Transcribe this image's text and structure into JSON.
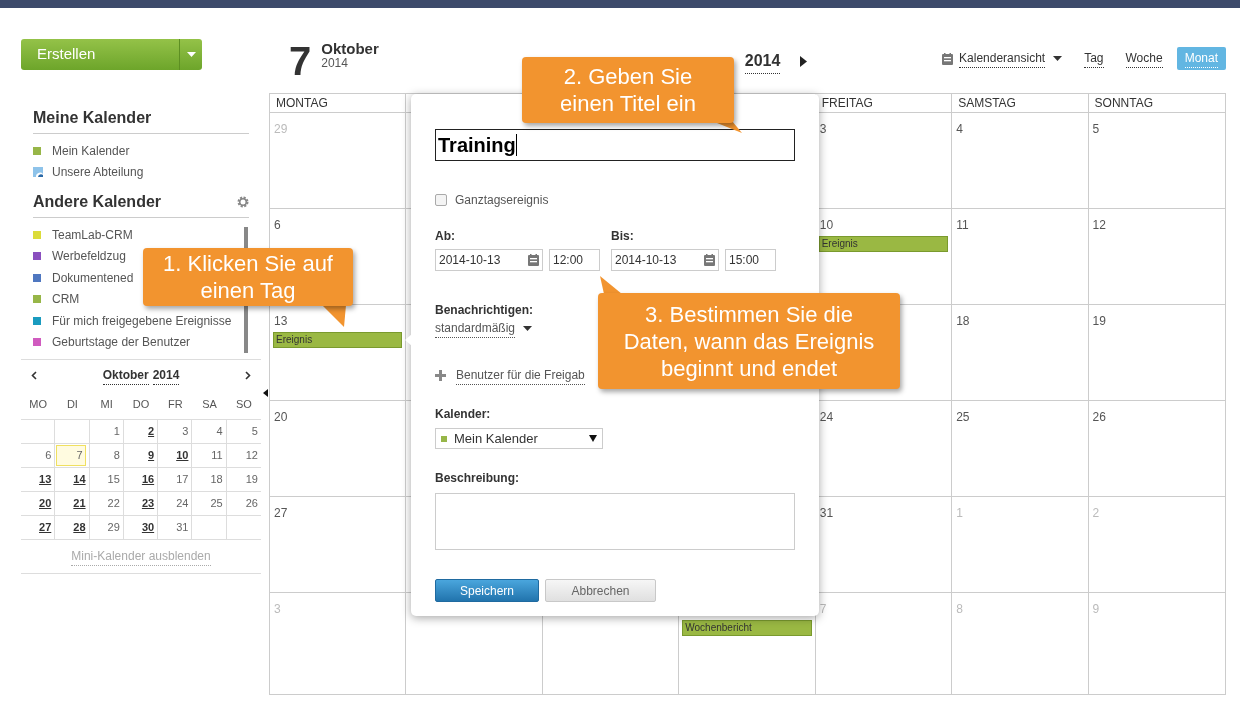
{
  "create_button": {
    "label": "Erstellen"
  },
  "my_calendars": {
    "title": "Meine Kalender",
    "items": [
      {
        "label": "Mein Kalender",
        "kind": "own",
        "color": "#97b648"
      },
      {
        "label": "Unsere Abteilung",
        "kind": "shared"
      }
    ]
  },
  "other_calendars": {
    "title": "Andere Kalender",
    "items": [
      {
        "label": "TeamLab-CRM",
        "color": "#dcdc3a"
      },
      {
        "label": "Werbefeldzug",
        "color": "#8a4fbf"
      },
      {
        "label": "Dokumentened",
        "color": "#4f77c0"
      },
      {
        "label": "CRM",
        "color": "#97b648"
      },
      {
        "label": "Für mich freigegebene Ereignisse",
        "color": "#1a9bbf"
      },
      {
        "label": "Geburtstage der Benutzer",
        "color": "#d05bbf"
      }
    ]
  },
  "mini_calendar": {
    "month": "Oktober",
    "year": "2014",
    "weekdays": [
      "MO",
      "DI",
      "MI",
      "DO",
      "FR",
      "SA",
      "SO"
    ],
    "weeks": [
      [
        {
          "day": "1",
          "bold": false,
          "today": false
        },
        {
          "day": "2",
          "bold": true,
          "today": false
        },
        {
          "day": "3",
          "bold": false,
          "today": false
        },
        {
          "day": "4",
          "bold": false,
          "today": false
        },
        {
          "day": "5",
          "bold": false,
          "today": false
        }
      ],
      [
        {
          "day": "6",
          "bold": false,
          "today": false
        },
        {
          "day": "7",
          "bold": false,
          "today": true
        },
        {
          "day": "8",
          "bold": false,
          "today": false
        },
        {
          "day": "9",
          "bold": true,
          "today": false
        },
        {
          "day": "10",
          "bold": true,
          "today": false
        },
        {
          "day": "11",
          "bold": false,
          "today": false
        },
        {
          "day": "12",
          "bold": false,
          "today": false
        }
      ],
      [
        {
          "day": "13",
          "bold": true,
          "today": false
        },
        {
          "day": "14",
          "bold": true,
          "today": false
        },
        {
          "day": "15",
          "bold": false,
          "today": false
        },
        {
          "day": "16",
          "bold": true,
          "today": false
        },
        {
          "day": "17",
          "bold": false,
          "today": false
        },
        {
          "day": "18",
          "bold": false,
          "today": false
        },
        {
          "day": "19",
          "bold": false,
          "today": false
        }
      ],
      [
        {
          "day": "20",
          "bold": true,
          "today": false
        },
        {
          "day": "21",
          "bold": true,
          "today": false
        },
        {
          "day": "22",
          "bold": false,
          "today": false
        },
        {
          "day": "23",
          "bold": true,
          "today": false
        },
        {
          "day": "24",
          "bold": false,
          "today": false
        },
        {
          "day": "25",
          "bold": false,
          "today": false
        },
        {
          "day": "26",
          "bold": false,
          "today": false
        }
      ],
      [
        {
          "day": "27",
          "bold": true,
          "today": false
        },
        {
          "day": "28",
          "bold": true,
          "today": false
        },
        {
          "day": "29",
          "bold": false,
          "today": false
        },
        {
          "day": "30",
          "bold": true,
          "today": false
        },
        {
          "day": "31",
          "bold": false,
          "today": false
        }
      ]
    ],
    "hide_link": "Mini-Kalender ausblenden"
  },
  "date_badge": {
    "day": "7",
    "month": "Oktober",
    "year": "2014"
  },
  "month_title": "2014",
  "view_switch": {
    "label": "Kalenderansicht",
    "views": [
      {
        "label": "Tag",
        "selected": false
      },
      {
        "label": "Woche",
        "selected": false
      },
      {
        "label": "Monat",
        "selected": true
      }
    ]
  },
  "month_grid": {
    "weekdays": {
      "mo": "MONTAG",
      "fr": "FREITAG",
      "sa": "SAMSTAG",
      "so": "SONNTAG"
    },
    "weeks": [
      {
        "mo": {
          "day": "29",
          "other_month": true
        },
        "fr": {
          "day": "3",
          "other_month": false
        },
        "sa": {
          "day": "4",
          "other_month": false
        },
        "so": {
          "day": "5",
          "other_month": false
        }
      },
      {
        "mo": {
          "day": "6",
          "other_month": false
        },
        "fr": {
          "day": "10",
          "other_month": false,
          "events": [
            "Ereignis"
          ]
        },
        "sa": {
          "day": "11",
          "other_month": false
        },
        "so": {
          "day": "12",
          "other_month": false
        }
      },
      {
        "mo": {
          "day": "13",
          "other_month": false,
          "events": [
            "Ereignis"
          ]
        },
        "sa": {
          "day": "18",
          "other_month": false
        },
        "so": {
          "day": "19",
          "other_month": false
        }
      },
      {
        "mo": {
          "day": "20",
          "other_month": false
        },
        "fr": {
          "day": "24",
          "other_month": false
        },
        "sa": {
          "day": "25",
          "other_month": false
        },
        "so": {
          "day": "26",
          "other_month": false
        }
      },
      {
        "mo": {
          "day": "27",
          "other_month": false
        },
        "fr": {
          "day": "31",
          "other_month": false
        },
        "sa": {
          "day": "1",
          "other_month": true
        },
        "so": {
          "day": "2",
          "other_month": true
        }
      },
      {
        "mo": {
          "day": "3",
          "other_month": true
        },
        "do": {
          "events": [
            "Wochenbericht"
          ]
        },
        "fr": {
          "day": "7",
          "other_month": true
        },
        "sa": {
          "day": "8",
          "other_month": true
        },
        "so": {
          "day": "9",
          "other_month": true
        }
      }
    ]
  },
  "event_form": {
    "title_value": "Training",
    "all_day": {
      "label": "Ganztagsereignis",
      "checked": false
    },
    "from": {
      "label": "Ab:",
      "date": "2014-10-13",
      "time": "12:00"
    },
    "to": {
      "label": "Bis:",
      "date": "2014-10-13",
      "time": "15:00"
    },
    "notify": {
      "label": "Benachrichtigen:",
      "value": "standardmäßig"
    },
    "share_link": "Benutzer für die Freigab",
    "calendar": {
      "label": "Kalender:",
      "value": "Mein Kalender"
    },
    "description": {
      "label": "Beschreibung:"
    },
    "buttons": [
      {
        "label": "Speichern",
        "kind": "primary"
      },
      {
        "label": "Abbrechen",
        "kind": "secondary"
      }
    ]
  },
  "callouts": [
    {
      "text": "1. Klicken Sie auf einen Tag"
    },
    {
      "text": "2. Geben Sie einen Titel ein"
    },
    {
      "text": "3. Bestimmen Sie die Daten, wann das Ereignis beginnt und endet"
    }
  ]
}
